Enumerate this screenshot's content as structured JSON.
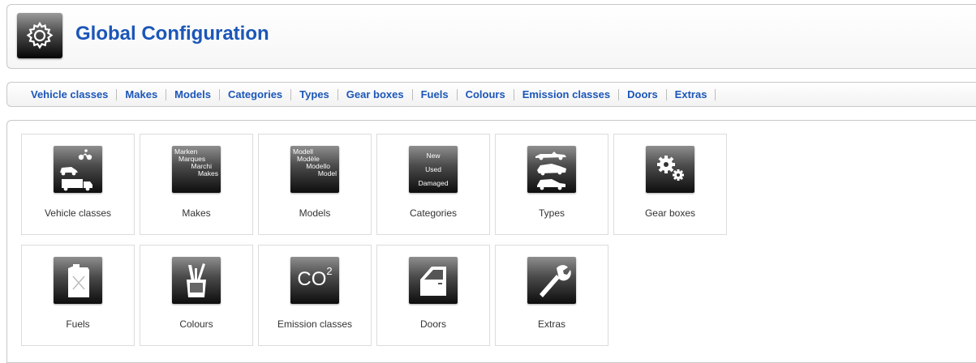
{
  "header": {
    "title": "Global Configuration",
    "icon": "gear-icon"
  },
  "tabs": [
    {
      "label": "Vehicle classes"
    },
    {
      "label": "Makes"
    },
    {
      "label": "Models"
    },
    {
      "label": "Categories"
    },
    {
      "label": "Types"
    },
    {
      "label": "Gear boxes"
    },
    {
      "label": "Fuels"
    },
    {
      "label": "Colours"
    },
    {
      "label": "Emission classes"
    },
    {
      "label": "Doors"
    },
    {
      "label": "Extras"
    }
  ],
  "tiles": [
    {
      "label": "Vehicle classes",
      "icon": "vehicle-classes-icon"
    },
    {
      "label": "Makes",
      "icon": "makes-icon",
      "icon_text": [
        "Marken",
        "Marques",
        "Marchi",
        "Makes"
      ]
    },
    {
      "label": "Models",
      "icon": "models-icon",
      "icon_text": [
        "Modell",
        "Modèle",
        "Modello",
        "Model"
      ]
    },
    {
      "label": "Categories",
      "icon": "categories-icon",
      "icon_text": [
        "New",
        "Used",
        "Damaged"
      ]
    },
    {
      "label": "Types",
      "icon": "types-icon"
    },
    {
      "label": "Gear boxes",
      "icon": "gears-icon"
    },
    {
      "label": "Fuels",
      "icon": "fuel-can-icon"
    },
    {
      "label": "Colours",
      "icon": "paint-bucket-icon"
    },
    {
      "label": "Emission classes",
      "icon": "co2-icon",
      "icon_text": [
        "CO",
        "2"
      ]
    },
    {
      "label": "Doors",
      "icon": "door-icon"
    },
    {
      "label": "Extras",
      "icon": "wrench-icon"
    }
  ],
  "colors": {
    "accent": "#1b56b8",
    "label_text": "#333333",
    "border": "#c8c8c8"
  }
}
